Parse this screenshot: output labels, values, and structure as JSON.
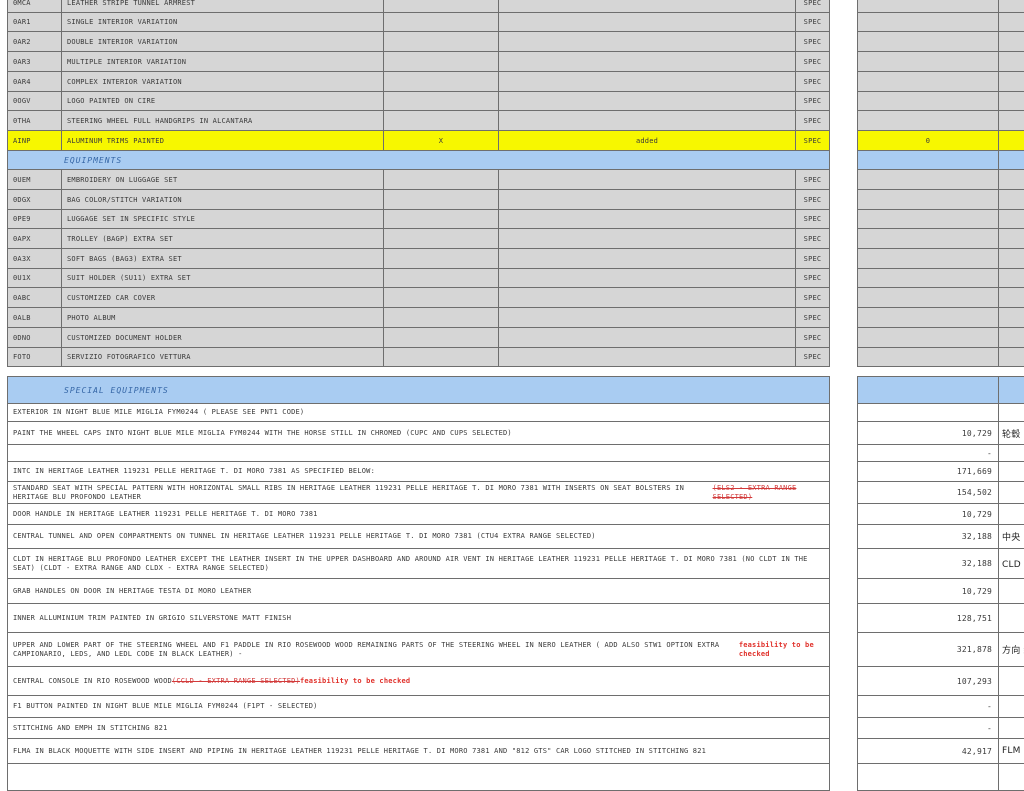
{
  "rows_top": [
    {
      "code": "0MCA",
      "desc": "LEATHER STRIPE TUNNEL ARMREST",
      "spec": "SPEC"
    },
    {
      "code": "0AR1",
      "desc": "SINGLE INTERIOR VARIATION",
      "spec": "SPEC"
    },
    {
      "code": "0AR2",
      "desc": "DOUBLE INTERIOR VARIATION",
      "spec": "SPEC"
    },
    {
      "code": "0AR3",
      "desc": "MULTIPLE INTERIOR VARIATION",
      "spec": "SPEC"
    },
    {
      "code": "0AR4",
      "desc": "COMPLEX INTERIOR VARIATION",
      "spec": "SPEC"
    },
    {
      "code": "0OGV",
      "desc": "LOGO PAINTED ON CIRE",
      "spec": "SPEC"
    },
    {
      "code": "0THA",
      "desc": "STEERING WHEEL FULL HANDGRIPS IN ALCANTARA",
      "spec": "SPEC"
    }
  ],
  "highlight_row": {
    "code": "AINP",
    "desc": "ALUMINUM TRIMS PAINTED",
    "mark": "X",
    "status": "added",
    "spec": "SPEC",
    "value": "0"
  },
  "section_equipments": "EQUIPMENTS",
  "rows_equip": [
    {
      "code": "0UEM",
      "desc": "EMBROIDERY ON LUGGAGE SET",
      "spec": "SPEC"
    },
    {
      "code": "0DGX",
      "desc": "BAG COLOR/STITCH VARIATION",
      "spec": "SPEC"
    },
    {
      "code": "0PE9",
      "desc": "LUGGAGE SET IN SPECIFIC STYLE",
      "spec": "SPEC"
    },
    {
      "code": "0APX",
      "desc": "TROLLEY (BAGP) EXTRA SET",
      "spec": "SPEC"
    },
    {
      "code": "0A3X",
      "desc": "SOFT BAGS (BAG3) EXTRA SET",
      "spec": "SPEC"
    },
    {
      "code": "0U1X",
      "desc": "SUIT HOLDER (SU11) EXTRA SET",
      "spec": "SPEC"
    },
    {
      "code": "0ABC",
      "desc": "CUSTOMIZED CAR COVER",
      "spec": "SPEC"
    },
    {
      "code": "0ALB",
      "desc": "PHOTO ALBUM",
      "spec": "SPEC"
    },
    {
      "code": "0DNO",
      "desc": "CUSTOMIZED DOCUMENT HOLDER",
      "spec": "SPEC"
    },
    {
      "code": "FOTO",
      "desc": "SERVIZIO FOTOGRAFICO VETTURA",
      "spec": "SPEC"
    }
  ],
  "section_special": "SPECIAL EQUIPMENTS",
  "special_rows": [
    {
      "desc": "EXTERIOR IN NIGHT BLUE MILE MIGLIA FYM0244 ( PLEASE SEE PNT1 CODE)",
      "price": "",
      "note": ""
    },
    {
      "desc": "PAINT THE WHEEL CAPS INTO NIGHT BLUE MILE MIGLIA FYM0244 WITH THE HORSE STILL IN CHROMED (CUPC AND CUPS SELECTED)",
      "price": "10,729",
      "note": "轮毂"
    },
    {
      "desc": "",
      "price": "-",
      "note": ""
    },
    {
      "desc": "INTC IN HERITAGE LEATHER 119231 PELLE HERITAGE T. DI MORO 7381  AS SPECIFIED BELOW:",
      "price": "171,669",
      "note": ""
    },
    {
      "desc": "STANDARD SEAT WITH SPECIAL PATTERN WITH HORIZONTAL SMALL RIBS IN HERITAGE LEATHER 119231 PELLE HERITAGE T. DI MORO 7381  WITH INSERTS ON SEAT BOLSTERS IN HERITAGE BLU PROFONDO LEATHER",
      "strike": "(ELS2 - EXTRA RANGE SELECTED)",
      "price": "154,502",
      "note": ""
    },
    {
      "desc": "DOOR HANDLE IN HERITAGE LEATHER 119231 PELLE HERITAGE T. DI MORO 7381",
      "price": "10,729",
      "note": ""
    },
    {
      "desc": "CENTRAL TUNNEL AND OPEN COMPARTMENTS ON TUNNEL  IN HERITAGE LEATHER 119231 PELLE HERITAGE T. DI MORO 7381  (CTU4 EXTRA RANGE SELECTED)",
      "price": "32,188",
      "note": "中央"
    },
    {
      "desc": "CLDT IN HERITAGE BLU PROFONDO LEATHER EXCEPT THE LEATHER INSERT IN THE UPPER DASHBOARD AND AROUND AIR VENT IN HERITAGE LEATHER 119231 PELLE HERITAGE T. DI MORO 7381 (NO CLDT IN THE SEAT) (CLDT - EXTRA RANGE AND CLDX - EXTRA RANGE SELECTED)",
      "price": "32,188",
      "note": "CLD 革插入"
    },
    {
      "desc": "GRAB HANDLES ON DOOR IN HERITAGE TESTA DI MORO LEATHER",
      "price": "10,729",
      "note": ""
    },
    {
      "desc": "INNER ALLUMINIUM TRIM PAINTED IN GRIGIO SILVERSTONE MATT FINISH",
      "price": "128,751",
      "note": ""
    },
    {
      "desc": "UPPER AND LOWER PART OF THE STEERING WHEEL AND F1 PADDLE IN RIO ROSEWOOD WOOD REMAINING PARTS OF THE STEERING WHEEL IN NERO LEATHER  ( ADD ALSO STW1 OPTION EXTRA CAMPIONARIO, LEDS, AND LEDL CODE IN BLACK LEATHER) -",
      "red": "feasibility to be checked",
      "price": "321,878",
      "note": "方向 红"
    },
    {
      "desc": "CENTRAL CONSOLE IN  RIO ROSEWOOD WOOD",
      "strike": "(CCLD - EXTRA RANGE SELECTED)",
      "red": "feasibility to be checked",
      "price": "107,293",
      "note": ""
    },
    {
      "desc": "F1 BUTTON PAINTED IN NIGHT BLUE MILE MIGLIA FYM0244 (F1PT - SELECTED)",
      "price": "-",
      "note": ""
    },
    {
      "desc": "STITCHING AND EMPH IN STITCHING 821",
      "price": "-",
      "note": ""
    },
    {
      "desc": "FLMA IN BLACK MOQUETTE WITH SIDE INSERT AND PIPING IN HERITAGE LEATHER 119231 PELLE HERITAGE T. DI MORO 7381 AND \"812 GTS\" CAR LOGO STITCHED IN STITCHING 821",
      "price": "42,917",
      "note": "FLM"
    },
    {
      "desc": "",
      "price": "",
      "note": ""
    }
  ]
}
